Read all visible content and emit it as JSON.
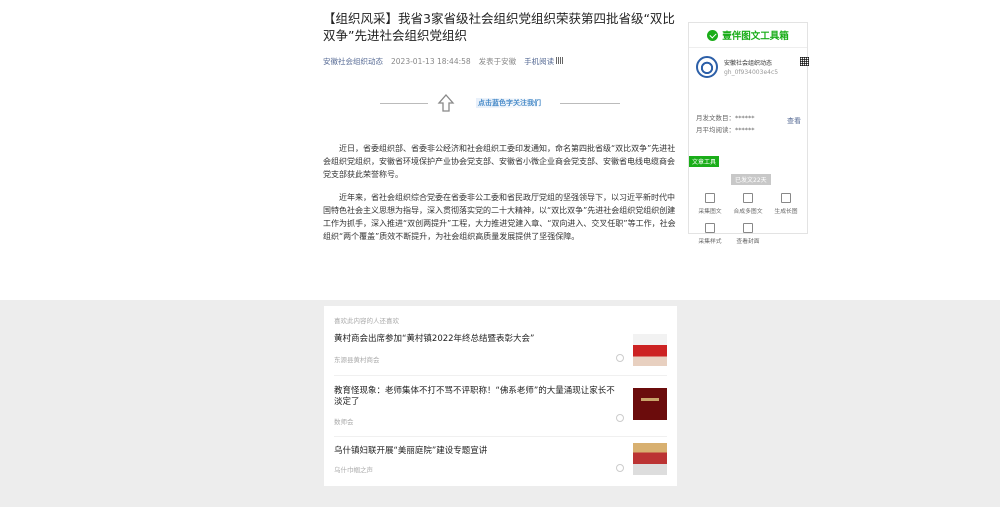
{
  "article": {
    "title": "【组织风采】我省3家省级社会组织党组织荣获第四批省级“双比双争”先进社会组织党组织",
    "source": "安徽社会组织动态",
    "datetime": "2023-01-13 18:44:58",
    "location": "发表于安徽",
    "mobile_read": "手机阅读",
    "follow_text": "点击蓝色字关注我们",
    "paragraphs": [
      "近日，省委组织部、省委非公经济和社会组织工委印发通知，命名第四批省级“双比双争”先进社会组织党组织，安徽省环境保护产业协会党支部、安徽省小微企业商会党支部、安徽省电线电缆商会党支部获此荣誉称号。",
      "近年来，省社会组织综合党委在省委非公工委和省民政厅党组的坚强领导下，以习近平新时代中国特色社会主义思想为指导，深入贯彻落实党的二十大精神，以“双比双争”先进社会组织党组织创建工作为抓手，深入推进“双创两提升”工程，大力推进党建入章、“双向进入、交叉任职”等工作，社会组织“两个覆盖”质效不断提升，为社会组织高质量发展提供了坚强保障。"
    ]
  },
  "toolbox": {
    "title": "壹伴图文工具箱",
    "account_name": "安徽社会组织动态",
    "account_id": "gh_0f934003e4c5",
    "monthly_posts": "月发文数目：******",
    "monthly_reads": "月平均阅读：******",
    "view_label": "查看",
    "tools_tag": "文章工具",
    "today_posts": "已发文22天",
    "tools": [
      {
        "label": "采集图文",
        "icon": "collect-icon"
      },
      {
        "label": "合成多图文",
        "icon": "merge-icon"
      },
      {
        "label": "生成长图",
        "icon": "long-image-icon"
      },
      {
        "label": "采集样式",
        "icon": "style-icon"
      },
      {
        "label": "查看封面",
        "icon": "cover-icon"
      }
    ]
  },
  "recommend": {
    "heading": "喜欢此内容的人还喜欢",
    "items": [
      {
        "title": "黄村商会出席参加“黄村镇2022年终总结暨表彰大会”",
        "source": "东源县黄村商会"
      },
      {
        "title": "教育怪现象：老师集体不打不骂不评职称！“佛系老师”的大量涌现让家长不淡定了",
        "source": "数师会"
      },
      {
        "title": "乌什镇妇联开展“美丽庭院”建设专题宣讲",
        "source": "乌什巾帼之声"
      }
    ]
  },
  "colors": {
    "link": "#576b95",
    "brand_green": "#1aad19",
    "page_gray": "#ededed"
  }
}
